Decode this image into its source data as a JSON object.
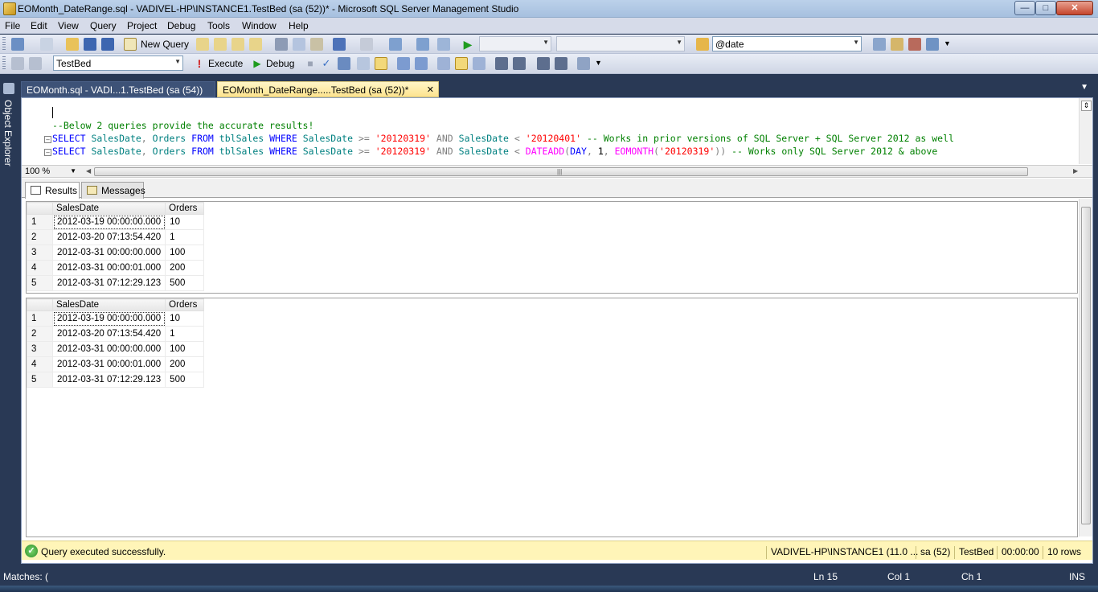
{
  "window": {
    "title": "EOMonth_DateRange.sql - VADIVEL-HP\\INSTANCE1.TestBed (sa (52))* - Microsoft SQL Server Management Studio"
  },
  "menu": [
    "File",
    "Edit",
    "View",
    "Query",
    "Project",
    "Debug",
    "Tools",
    "Window",
    "Help"
  ],
  "toolbar1": {
    "new_query_label": "New Query",
    "search_value": "@date"
  },
  "toolbar2": {
    "database": "TestBed",
    "execute_label": "Execute",
    "debug_label": "Debug"
  },
  "side_panel": {
    "label": "Object Explorer"
  },
  "doc_tabs": [
    {
      "label": "EOMonth.sql - VADI...1.TestBed (sa (54))",
      "active": false
    },
    {
      "label": "EOMonth_DateRange.....TestBed (sa (52))*",
      "active": true
    }
  ],
  "editor": {
    "lines": [
      {
        "type": "comment",
        "text": "--Below 2 queries provide the accurate results!"
      },
      {
        "type": "q1",
        "segments": [
          [
            "kw",
            "SELECT"
          ],
          [
            "",
            " "
          ],
          [
            "ident",
            "SalesDate"
          ],
          [
            "gray",
            ","
          ],
          [
            "",
            " "
          ],
          [
            "ident",
            "Orders"
          ],
          [
            "",
            " "
          ],
          [
            "kw",
            "FROM"
          ],
          [
            "",
            " "
          ],
          [
            "ident",
            "tblSales"
          ],
          [
            "",
            " "
          ],
          [
            "kw",
            "WHERE"
          ],
          [
            "",
            " "
          ],
          [
            "ident",
            "SalesDate"
          ],
          [
            "",
            " "
          ],
          [
            "gray",
            ">="
          ],
          [
            "",
            " "
          ],
          [
            "str",
            "'20120319'"
          ],
          [
            "",
            " "
          ],
          [
            "gray",
            "AND"
          ],
          [
            "",
            " "
          ],
          [
            "ident",
            "SalesDate"
          ],
          [
            "",
            " "
          ],
          [
            "gray",
            "<"
          ],
          [
            "",
            " "
          ],
          [
            "str",
            "'20120401'"
          ],
          [
            "",
            " "
          ],
          [
            "cmt",
            "-- Works in prior versions of SQL Server + SQL Server 2012 as well"
          ]
        ]
      },
      {
        "type": "q2",
        "segments": [
          [
            "kw",
            "SELECT"
          ],
          [
            "",
            " "
          ],
          [
            "ident",
            "SalesDate"
          ],
          [
            "gray",
            ","
          ],
          [
            "",
            " "
          ],
          [
            "ident",
            "Orders"
          ],
          [
            "",
            " "
          ],
          [
            "kw",
            "FROM"
          ],
          [
            "",
            " "
          ],
          [
            "ident",
            "tblSales"
          ],
          [
            "",
            " "
          ],
          [
            "kw",
            "WHERE"
          ],
          [
            "",
            " "
          ],
          [
            "ident",
            "SalesDate"
          ],
          [
            "",
            " "
          ],
          [
            "gray",
            ">="
          ],
          [
            "",
            " "
          ],
          [
            "str",
            "'20120319'"
          ],
          [
            "",
            " "
          ],
          [
            "gray",
            "AND"
          ],
          [
            "",
            " "
          ],
          [
            "ident",
            "SalesDate"
          ],
          [
            "",
            " "
          ],
          [
            "gray",
            "<"
          ],
          [
            "",
            " "
          ],
          [
            "fn",
            "DATEADD"
          ],
          [
            "gray",
            "("
          ],
          [
            "kw",
            "DAY"
          ],
          [
            "gray",
            ","
          ],
          [
            "",
            " 1"
          ],
          [
            "gray",
            ","
          ],
          [
            "",
            " "
          ],
          [
            "fn",
            "EOMONTH"
          ],
          [
            "gray",
            "("
          ],
          [
            "str",
            "'20120319'"
          ],
          [
            "gray",
            "))"
          ],
          [
            "",
            " "
          ],
          [
            "cmt",
            "-- Works only SQL Server 2012 & above"
          ]
        ]
      }
    ],
    "zoom": "100 %"
  },
  "result_tabs": [
    "Results",
    "Messages"
  ],
  "grids": [
    {
      "columns": [
        "SalesDate",
        "Orders"
      ],
      "rows": [
        [
          "1",
          "2012-03-19 00:00:00.000",
          "10"
        ],
        [
          "2",
          "2012-03-20 07:13:54.420",
          "1"
        ],
        [
          "3",
          "2012-03-31 00:00:00.000",
          "100"
        ],
        [
          "4",
          "2012-03-31 00:00:01.000",
          "200"
        ],
        [
          "5",
          "2012-03-31 07:12:29.123",
          "500"
        ]
      ]
    },
    {
      "columns": [
        "SalesDate",
        "Orders"
      ],
      "rows": [
        [
          "1",
          "2012-03-19 00:00:00.000",
          "10"
        ],
        [
          "2",
          "2012-03-20 07:13:54.420",
          "1"
        ],
        [
          "3",
          "2012-03-31 00:00:00.000",
          "100"
        ],
        [
          "4",
          "2012-03-31 00:00:01.000",
          "200"
        ],
        [
          "5",
          "2012-03-31 07:12:29.123",
          "500"
        ]
      ]
    }
  ],
  "query_status": {
    "message": "Query executed successfully.",
    "server": "VADIVEL-HP\\INSTANCE1 (11.0 ...",
    "user": "sa (52)",
    "database": "TestBed",
    "elapsed": "00:00:00",
    "rows": "10 rows"
  },
  "status_bar": {
    "matches": "Matches: (",
    "line": "Ln 15",
    "col": "Col 1",
    "ch": "Ch 1",
    "mode": "INS"
  },
  "colors": {
    "frame": "#293955",
    "active_tab": "#fde48f",
    "status_yellow": "#fff5b8"
  }
}
